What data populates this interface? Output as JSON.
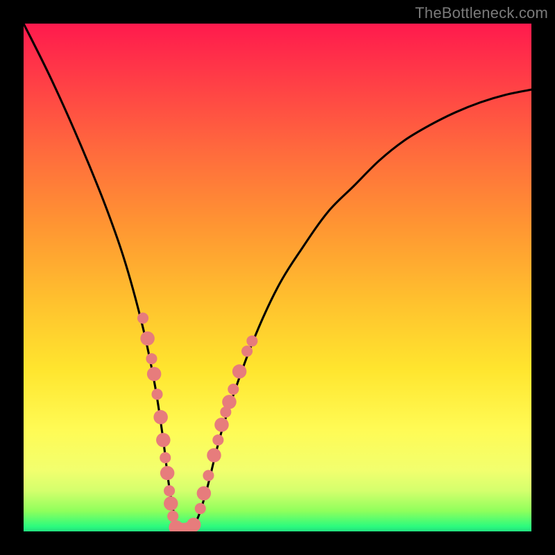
{
  "watermark": "TheBottleneck.com",
  "colors": {
    "background": "#000000",
    "curve": "#000000",
    "marker_fill": "#e77c7c",
    "gradient_stops": [
      "#ff1a4d",
      "#ff3a47",
      "#ff6a3d",
      "#ff9632",
      "#ffc22e",
      "#ffe52e",
      "#fffb55",
      "#f2ff6e",
      "#d4ff6d",
      "#8fff5c",
      "#2dfb7d",
      "#22e07f"
    ]
  },
  "chart_data": {
    "type": "line",
    "title": "",
    "xlabel": "",
    "ylabel": "",
    "xlim": [
      0,
      100
    ],
    "ylim": [
      0,
      100
    ],
    "grid": false,
    "series": [
      {
        "name": "bottleneck-curve",
        "x": [
          0,
          5,
          10,
          15,
          18,
          20,
          22,
          24,
          26,
          27.5,
          28.5,
          29.5,
          30.5,
          32,
          34,
          36,
          38,
          40,
          45,
          50,
          55,
          60,
          65,
          70,
          75,
          80,
          85,
          90,
          95,
          100
        ],
        "y": [
          100,
          90,
          79,
          67,
          59,
          53,
          46,
          38,
          28,
          18,
          10,
          4,
          0.5,
          0.3,
          2,
          8,
          16,
          23,
          37,
          48,
          56,
          63,
          68,
          73,
          77,
          80,
          82.5,
          84.5,
          86,
          87
        ]
      }
    ],
    "markers": [
      {
        "x": 23.5,
        "y": 42,
        "r": 1.1
      },
      {
        "x": 24.4,
        "y": 38,
        "r": 1.4
      },
      {
        "x": 25.2,
        "y": 34,
        "r": 1.1
      },
      {
        "x": 25.7,
        "y": 31,
        "r": 1.4
      },
      {
        "x": 26.3,
        "y": 27,
        "r": 1.1
      },
      {
        "x": 27.0,
        "y": 22.5,
        "r": 1.4
      },
      {
        "x": 27.5,
        "y": 18,
        "r": 1.4
      },
      {
        "x": 27.9,
        "y": 14.5,
        "r": 1.1
      },
      {
        "x": 28.3,
        "y": 11.5,
        "r": 1.4
      },
      {
        "x": 28.7,
        "y": 8,
        "r": 1.1
      },
      {
        "x": 29.0,
        "y": 5.5,
        "r": 1.4
      },
      {
        "x": 29.4,
        "y": 3.0,
        "r": 1.1
      },
      {
        "x": 30.0,
        "y": 0.8,
        "r": 1.4
      },
      {
        "x": 30.7,
        "y": 0.4,
        "r": 1.4
      },
      {
        "x": 31.7,
        "y": 0.3,
        "r": 1.4
      },
      {
        "x": 32.6,
        "y": 0.5,
        "r": 1.4
      },
      {
        "x": 33.5,
        "y": 1.3,
        "r": 1.4
      },
      {
        "x": 34.8,
        "y": 4.5,
        "r": 1.1
      },
      {
        "x": 35.5,
        "y": 7.5,
        "r": 1.4
      },
      {
        "x": 36.4,
        "y": 11,
        "r": 1.1
      },
      {
        "x": 37.5,
        "y": 15,
        "r": 1.4
      },
      {
        "x": 38.3,
        "y": 18,
        "r": 1.1
      },
      {
        "x": 39.0,
        "y": 21,
        "r": 1.4
      },
      {
        "x": 39.8,
        "y": 23.5,
        "r": 1.1
      },
      {
        "x": 40.5,
        "y": 25.5,
        "r": 1.4
      },
      {
        "x": 41.3,
        "y": 28,
        "r": 1.1
      },
      {
        "x": 42.5,
        "y": 31.5,
        "r": 1.4
      },
      {
        "x": 44.0,
        "y": 35.5,
        "r": 1.1
      },
      {
        "x": 45.0,
        "y": 37.5,
        "r": 1.1
      }
    ],
    "annotations": []
  }
}
